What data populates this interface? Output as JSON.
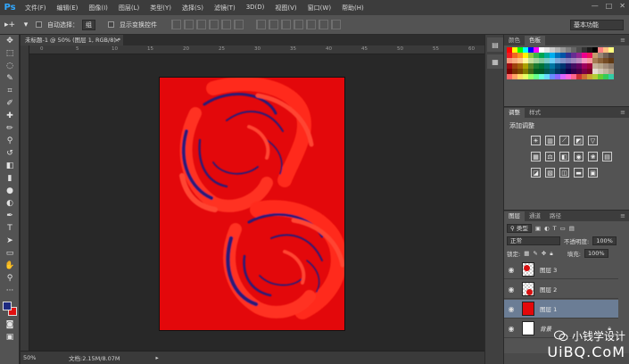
{
  "app": {
    "logo": "Ps"
  },
  "menu": [
    "文件(F)",
    "编辑(E)",
    "图像(I)",
    "图层(L)",
    "类型(Y)",
    "选择(S)",
    "滤镜(T)",
    "3D(D)",
    "视图(V)",
    "窗口(W)",
    "帮助(H)"
  ],
  "window_controls": {
    "minimize": "—",
    "maximize": "□",
    "close": "✕"
  },
  "options": {
    "auto_select_label": "自动选择：",
    "auto_select_value": "组",
    "show_transform_label": "显示变换控件",
    "workspace": "基本功能"
  },
  "document": {
    "tab_title": "未标题-1 @ 50% (图层 1, RGB/8) *",
    "close": "×",
    "ruler_marks": [
      "0",
      "5",
      "10",
      "15",
      "20",
      "25",
      "30",
      "35",
      "40",
      "45",
      "50",
      "55",
      "60"
    ],
    "zoom": "50%",
    "doc_info": "文档:2.15M/8.07M"
  },
  "panels": {
    "swatches_tabs": [
      "颜色",
      "色板"
    ],
    "adjust_tabs": [
      "调整",
      "样式"
    ],
    "adjust_title": "添加调整",
    "layers_tabs": [
      "图层",
      "通道",
      "路径"
    ],
    "layer_filter": "类型",
    "blend_mode": "正常",
    "opacity_label": "不透明度:",
    "opacity_value": "100%",
    "lock_label": "锁定:",
    "fill_label": "填充:",
    "fill_value": "100%",
    "layers": [
      {
        "name": "图层 3",
        "selected": false
      },
      {
        "name": "图层 2",
        "selected": false
      },
      {
        "name": "图层 1",
        "selected": true
      },
      {
        "name": "背景",
        "selected": false
      }
    ]
  },
  "watermark": {
    "line1": "小钱学设计",
    "line2": "UiBQ.CoM"
  },
  "colors": {
    "canvas_red": "#e3080b",
    "swirl_red": "#ff2a1a",
    "swirl_navy": "#2a1a78",
    "foreground": "#1e2a80",
    "background": "#e01010",
    "selected_layer": "#6b7d95"
  }
}
